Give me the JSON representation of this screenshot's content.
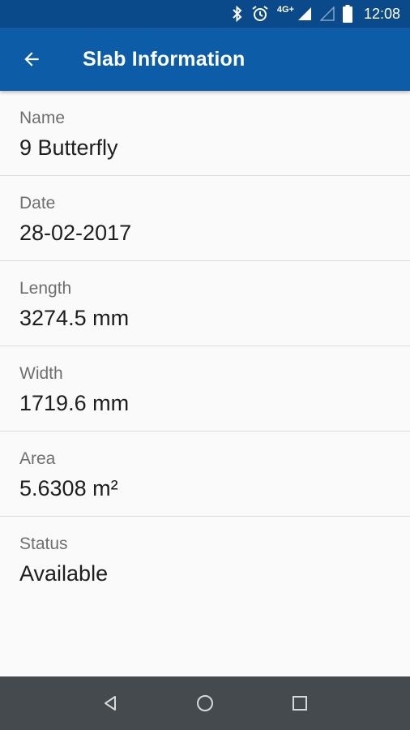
{
  "status_bar": {
    "network": "4G+",
    "time": "12:08",
    "icons": [
      "bluetooth-icon",
      "alarm-icon",
      "signal-icon",
      "signal-empty-icon",
      "battery-icon"
    ]
  },
  "app_bar": {
    "title": "Slab Information",
    "back_icon": "arrow-back-icon"
  },
  "fields": [
    {
      "label": "Name",
      "value": "9 Butterfly"
    },
    {
      "label": "Date",
      "value": "28-02-2017"
    },
    {
      "label": "Length",
      "value": "3274.5 mm"
    },
    {
      "label": "Width",
      "value": "1719.6 mm"
    },
    {
      "label": "Area",
      "value": "5.6308 m²"
    },
    {
      "label": "Status",
      "value": "Available"
    }
  ],
  "nav_bar": {
    "icons": [
      "back-triangle-icon",
      "home-circle-icon",
      "recents-square-icon"
    ]
  },
  "colors": {
    "status_bar": "#0a4a8a",
    "app_bar": "#0c5ca8",
    "background": "#fafafa",
    "nav_bar": "#454a4f"
  }
}
